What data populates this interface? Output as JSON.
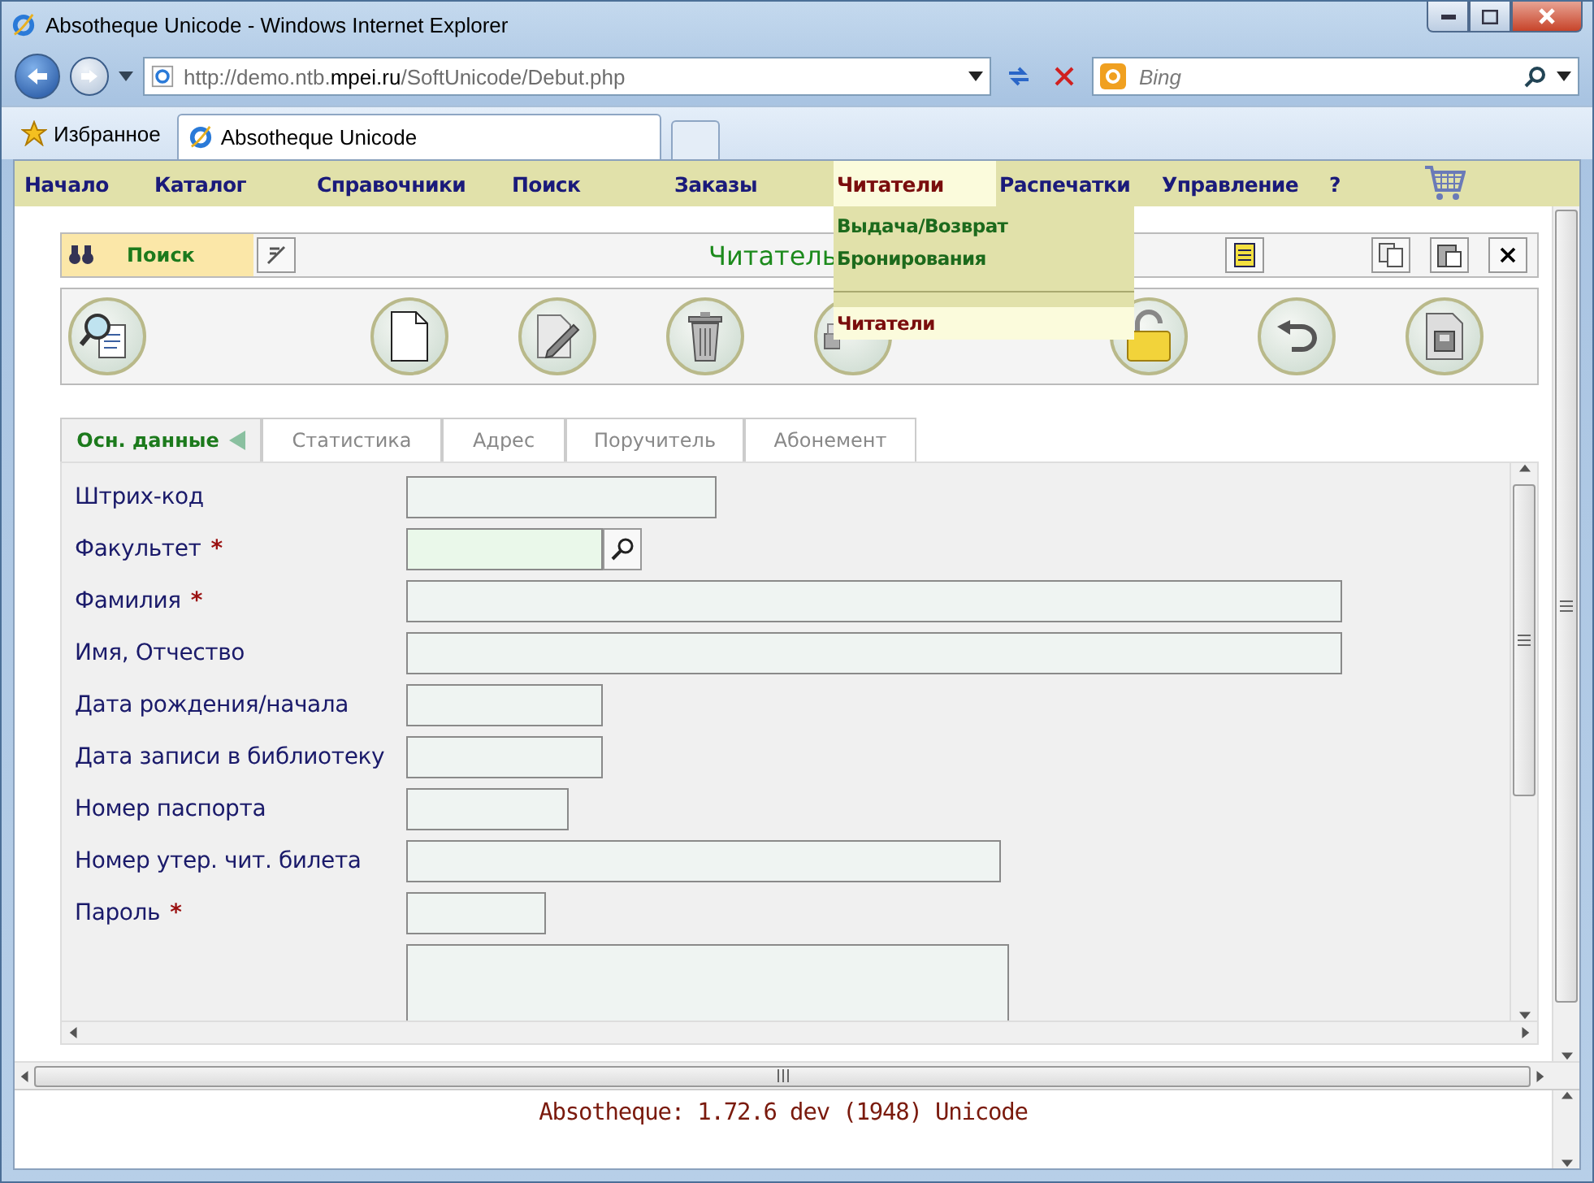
{
  "window": {
    "title": "Absotheque Unicode - Windows Internet Explorer"
  },
  "address_bar": {
    "url_prefix": "http://demo.ntb.",
    "url_host": "mpei.ru",
    "url_path": "/SoftUnicode/Debut.php"
  },
  "search": {
    "placeholder": "Bing"
  },
  "favorites": {
    "label": "Избранное"
  },
  "browser_tabs": [
    {
      "label": "Absotheque Unicode",
      "selected": true
    }
  ],
  "menu": [
    {
      "label": "Начало",
      "selected": false
    },
    {
      "label": "Каталог",
      "selected": false
    },
    {
      "label": "Справочники",
      "selected": false
    },
    {
      "label": "Поиск",
      "selected": false
    },
    {
      "label": "Заказы",
      "selected": false
    },
    {
      "label": "Читатели",
      "selected": true
    },
    {
      "label": "Распечатки",
      "selected": false
    },
    {
      "label": "Управление",
      "selected": false
    },
    {
      "label": "?",
      "selected": false
    }
  ],
  "dropdown": [
    {
      "kind": "item",
      "label": "Выдача/Возврат",
      "selected": false
    },
    {
      "kind": "item",
      "label": "Бронирования",
      "selected": false
    },
    {
      "kind": "separator"
    },
    {
      "kind": "item",
      "label": "Читатели",
      "selected": true
    }
  ],
  "panel": {
    "search_label": "Поиск",
    "title": "Читатель"
  },
  "form_tabs": [
    {
      "label": "Осн. данные",
      "selected": true
    },
    {
      "label": "Статистика",
      "selected": false
    },
    {
      "label": "Адрес",
      "selected": false
    },
    {
      "label": "Поручитель",
      "selected": false
    },
    {
      "label": "Абонемент",
      "selected": false
    }
  ],
  "fields": [
    {
      "label": "Штрих-код",
      "kind": "text"
    },
    {
      "label": "Факультет",
      "required_mark": "*",
      "kind": "lookup"
    },
    {
      "label": "Фамилия",
      "required_mark": "*",
      "kind": "text"
    },
    {
      "label": "Имя, Отчество",
      "kind": "text"
    },
    {
      "label": "Дата рождения/начала",
      "kind": "text"
    },
    {
      "label": "Дата записи в библиотеку",
      "kind": "text"
    },
    {
      "label": "Номер паспорта",
      "kind": "text"
    },
    {
      "label": "Номер утер. чит. билета",
      "kind": "text"
    },
    {
      "label": "Пароль",
      "required_mark": "*",
      "kind": "text"
    },
    {
      "kind": "textarea"
    }
  ],
  "footer": {
    "text": "Absotheque: 1.72.6 dev (1948) Unicode"
  }
}
